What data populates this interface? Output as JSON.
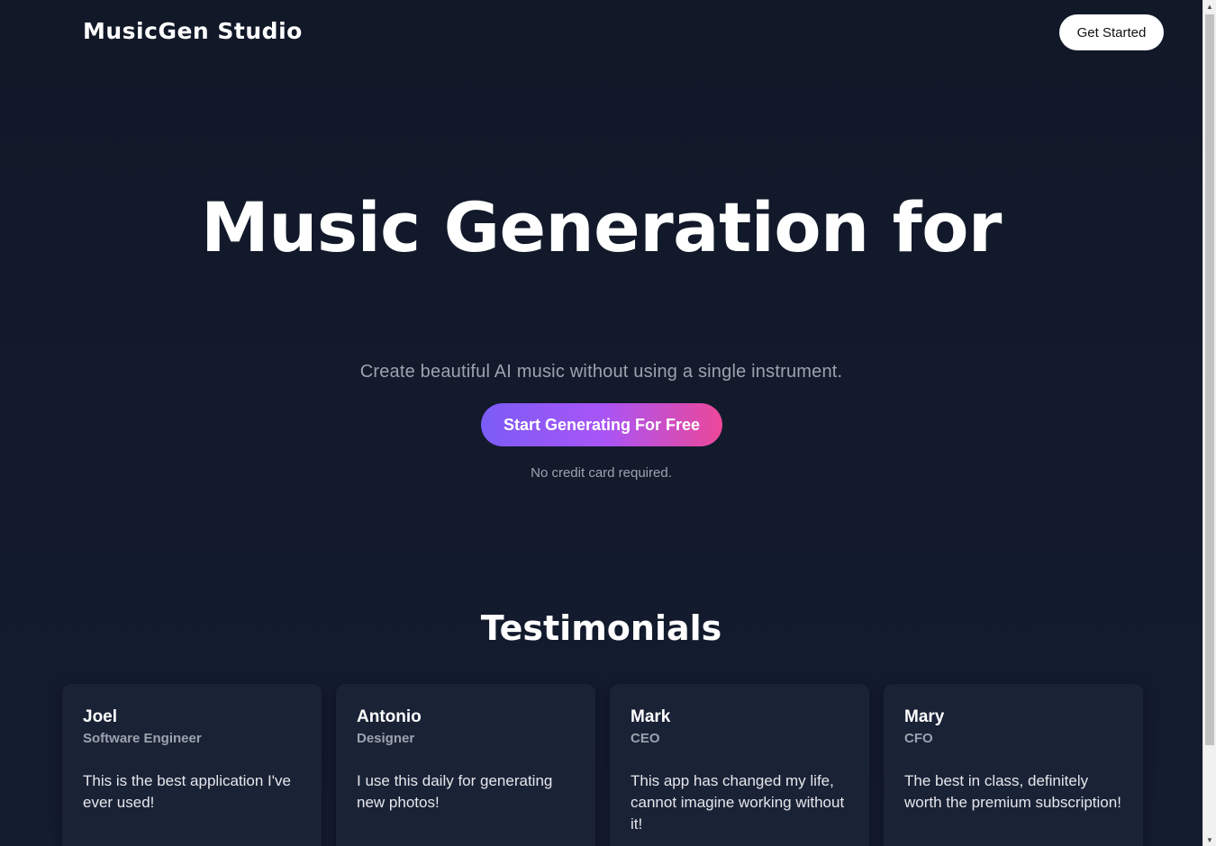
{
  "header": {
    "brand": "MusicGen Studio",
    "get_started_label": "Get Started"
  },
  "hero": {
    "title": "Music Generation for",
    "subtitle": "Create beautiful AI music without using a single instrument.",
    "cta_label": "Start Generating For Free",
    "note": "No credit card required."
  },
  "testimonials": {
    "title": "Testimonials",
    "items": [
      {
        "name": "Joel",
        "role": "Software Engineer",
        "text": "This is the best application I've ever used!"
      },
      {
        "name": "Antonio",
        "role": "Designer",
        "text": "I use this daily for generating new photos!"
      },
      {
        "name": "Mark",
        "role": "CEO",
        "text": "This app has changed my life, cannot imagine working without it!"
      },
      {
        "name": "Mary",
        "role": "CFO",
        "text": "The best in class, definitely worth the premium subscription!"
      }
    ]
  },
  "colors": {
    "background": "#121a2c",
    "card": "#1a2236",
    "muted_text": "#9ca3af",
    "gradient_start": "#7b5cf6",
    "gradient_end": "#ec4899"
  },
  "icons": {
    "scroll_up": "triangle-up-icon",
    "scroll_down": "triangle-down-icon"
  }
}
